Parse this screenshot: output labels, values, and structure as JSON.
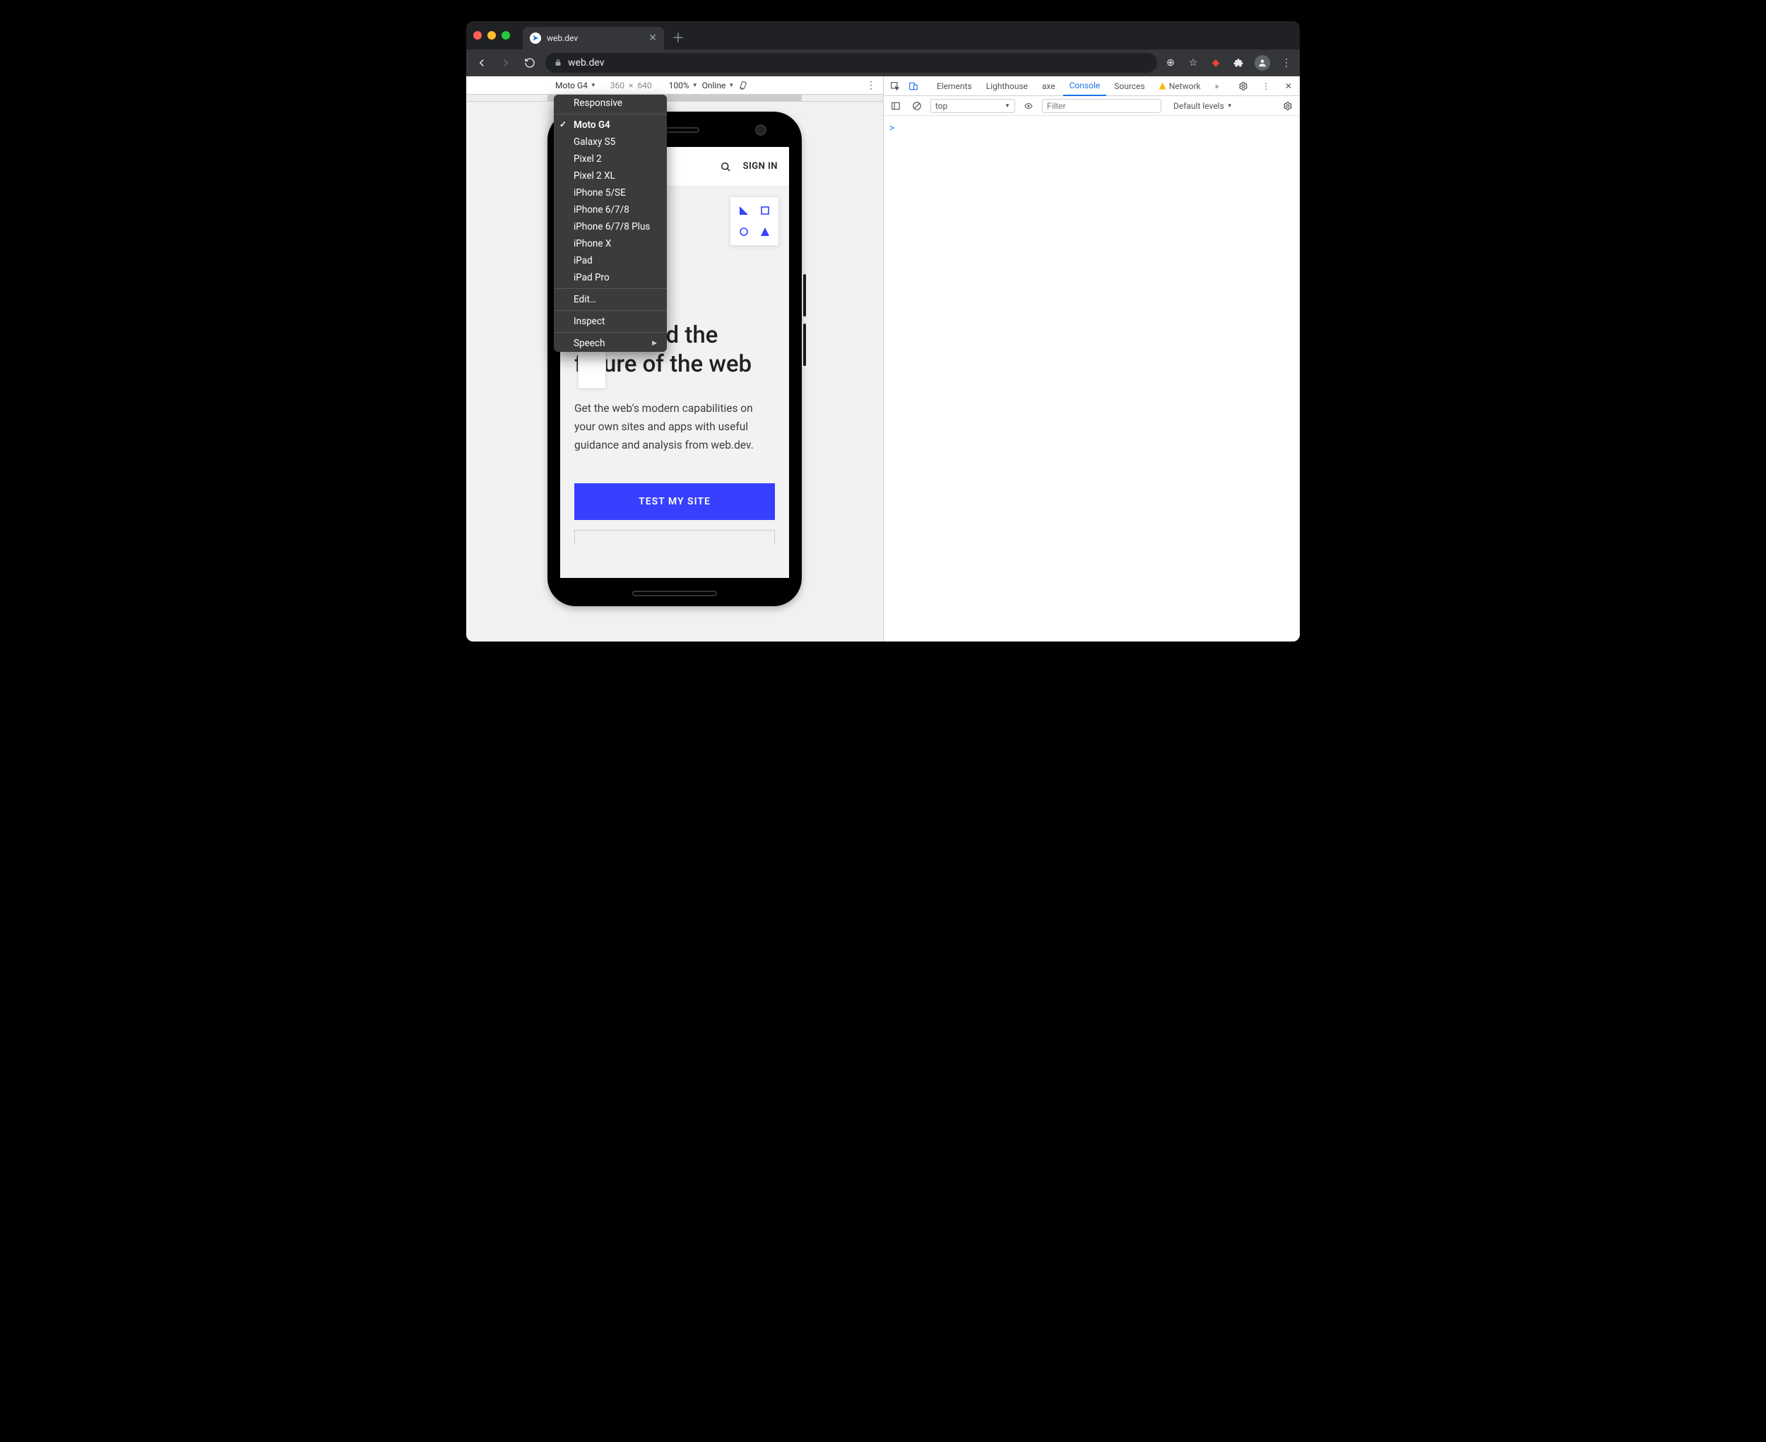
{
  "browser": {
    "tab_title": "web.dev",
    "url": "web.dev",
    "nav": {
      "add_icon": "⊕",
      "star_icon": "☆"
    }
  },
  "device_toolbar": {
    "device": "Moto G4",
    "width": "360",
    "height": "640",
    "zoom": "100%",
    "throttling": "Online"
  },
  "device_menu": {
    "responsive": "Responsive",
    "devices": [
      "Moto G4",
      "Galaxy S5",
      "Pixel 2",
      "Pixel 2 XL",
      "iPhone 5/SE",
      "iPhone 6/7/8",
      "iPhone 6/7/8 Plus",
      "iPhone X",
      "iPad",
      "iPad Pro"
    ],
    "selected": "Moto G4",
    "edit": "Edit…",
    "inspect": "Inspect",
    "speech": "Speech"
  },
  "site": {
    "sign_in": "SIGN IN",
    "hero_title": "Let's build the future of the web",
    "hero_body": "Get the web's modern capabilities on your own sites and apps with useful guidance and analysis from web.dev.",
    "cta": "TEST MY SITE"
  },
  "devtools": {
    "tabs": [
      "Elements",
      "Lighthouse",
      "axe",
      "Console",
      "Sources",
      "Network"
    ],
    "active_tab": "Console",
    "more_tabs": "»"
  },
  "console": {
    "context": "top",
    "filter_placeholder": "Filter",
    "levels": "Default levels",
    "prompt": ">"
  }
}
